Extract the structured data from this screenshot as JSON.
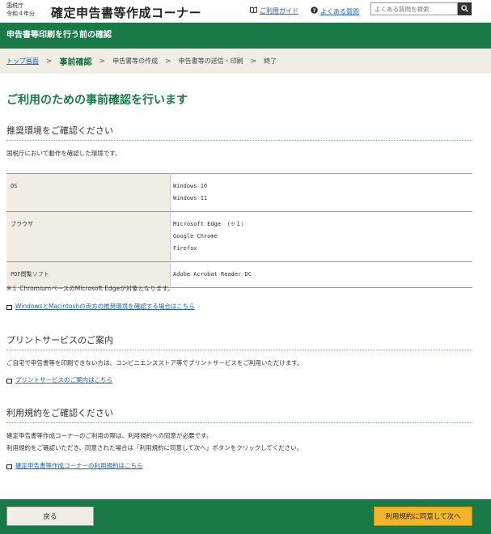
{
  "header": {
    "agency_name": "国税庁",
    "era_year": "令和４年分",
    "app_title": "確定申告書等作成コーナー",
    "guide_link": "ご利用ガイド",
    "faq_link": "よくある質問",
    "search_placeholder": "よくある質問を検索"
  },
  "band": {
    "title": "申告書等印刷を行う前の確認"
  },
  "breadcrumb": {
    "items": [
      "トップ画面",
      "事前確認",
      "申告書等の作成",
      "申告書等の送信・印刷",
      "終了"
    ],
    "separator": ">"
  },
  "main": {
    "title": "ご利用のための事前確認を行います"
  },
  "env_section": {
    "title": "推奨環境をご確認ください",
    "intro": "国税庁において動作を確認した環境です。",
    "rows": [
      {
        "label": "OS",
        "values": [
          "Windows 10",
          "Windows 11"
        ]
      },
      {
        "label": "ブラウザ",
        "values": [
          "Microsoft Edge （※１）",
          "Google Chrome",
          "Firefox"
        ]
      },
      {
        "label": "PDF閲覧ソフト",
        "values": [
          "Adobe Acrobat Reader DC"
        ]
      }
    ],
    "note": "※１ ChromiumベースのMicrosoft Edgeが対象となります。",
    "link": "WindowsとMacintoshの両方の推奨環境を確認する場合はこちら"
  },
  "print_section": {
    "title": "プリントサービスのご案内",
    "text": "ご自宅で申告書等を印刷できない方は、コンビニエンスストア等でプリントサービスをご利用いただけます。",
    "link": "プリントサービスのご案内はこちら"
  },
  "terms_section": {
    "title": "利用規約をご確認ください",
    "text1": "確定申告書等作成コーナーのご利用の際は、利用規約への同意が必要です。",
    "text2": "利用規約をご確認いただき、同意された場合は「利用規約に同意して次へ」ボタンをクリックしてください。",
    "link": "確定申告書等作成コーナーの利用規約はこちら"
  },
  "footer": {
    "back_label": "戻る",
    "agree_label": "利用規約に同意して次へ"
  },
  "colors": {
    "brand_green": "#1a7a47",
    "accent_orange": "#f5b52a",
    "link_blue": "#1a5fb4"
  },
  "icons": {
    "guide": "book-icon",
    "faq": "question-circle-icon",
    "search": "search-icon",
    "external": "window-icon"
  }
}
